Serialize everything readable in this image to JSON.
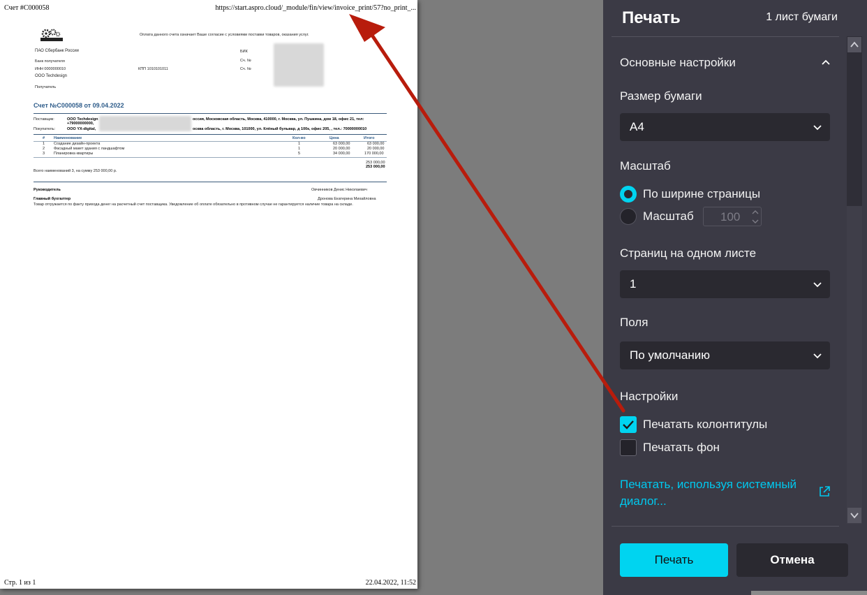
{
  "preview": {
    "header_left": "Счет #C000058",
    "header_right": "https://start.aspro.cloud/_module/fin/view/invoice_print/57?no_print_...",
    "footer_left": "Стр. 1 из 1",
    "footer_right": "22.04.2022, 11:52",
    "notice": "Оплата данного счета означает Ваше согласие с условиями поставки товаров, оказания услуг.",
    "bank_name": "ПАО Сбербанк России",
    "bik_label": "БИК",
    "bank_recipient_label": "Банк получателя",
    "acc_label_1": "Сч. №",
    "inn": "ИНН 0000000010",
    "kpp": "КПП 1010101011",
    "acc_label_2": "Сч. №",
    "company": "ООО Techdesign",
    "recipient_label": "Получатель",
    "invoice_title": "Счет №C000058 от 09.04.2022",
    "supplier_label": "Поставщик:",
    "supplier_value_1": "ООО Techdesign",
    "supplier_value_2": "оссия, Московская область, Москва, 410000, г. Москва, ул. Пушкина, дом 18, офис 21, тел:",
    "supplier_value_3": "+79000000000,",
    "buyer_label": "Покупатель:",
    "buyer_value_1": "ООО YX-digital,",
    "buyer_value_2": "осква область, г. Москва, 101000, ул. Клёный бульвар, д 100к, офис 205, , тел.: 70000000010",
    "table": {
      "headers": [
        "#",
        "Наименование",
        "Кол-во",
        "Цена",
        "Итого"
      ],
      "rows": [
        [
          "1",
          "Создание дизайн-проекта",
          "1",
          "63 000,00",
          "63 000,00"
        ],
        [
          "2",
          "Фасадный макет здания с ландшафтом",
          "1",
          "20 000,00",
          "20 000,00"
        ],
        [
          "3",
          "Планировка квартиры",
          "5",
          "34 000,00",
          "170 000,00"
        ]
      ],
      "total_1": "253 000,00",
      "total_2": "253 000,00"
    },
    "summary": "Всего наименований 3, на сумму 253 000,00 р.",
    "director_label": "Руководитель",
    "director_name": "Овчинников Денис Николаевич",
    "accountant_label": "Главный бухгалтер",
    "accountant_name": "Дронова Екатерина Михайловна",
    "note": "Товар отгружается по факту прихода денег на расчетный счет поставщика. Уведомление об оплате обязательно в противном случае не гарантируется наличие товара на складе."
  },
  "panel": {
    "title": "Печать",
    "sheets": "1 лист бумаги",
    "section_title": "Основные настройки",
    "paper_size_label": "Размер бумаги",
    "paper_size_value": "A4",
    "scale_label": "Масштаб",
    "fit_width_label": "По ширине страницы",
    "scale_option_label": "Масштаб",
    "scale_value": "100",
    "pages_per_sheet_label": "Страниц на одном листе",
    "pages_per_sheet_value": "1",
    "margins_label": "Поля",
    "margins_value": "По умолчанию",
    "settings_label": "Настройки",
    "headers_footers_label": "Печатать колонтитулы",
    "headers_footers_checked": true,
    "background_label": "Печатать фон",
    "background_checked": false,
    "system_dialog_link": "Печатать, используя системный диалог...",
    "print_button": "Печать",
    "cancel_button": "Отмена"
  },
  "colors": {
    "accent": "#00d4f0",
    "panel_bg": "#3b3a45",
    "field_bg": "#2a2930",
    "annotation_arrow": "#b81c0c"
  }
}
